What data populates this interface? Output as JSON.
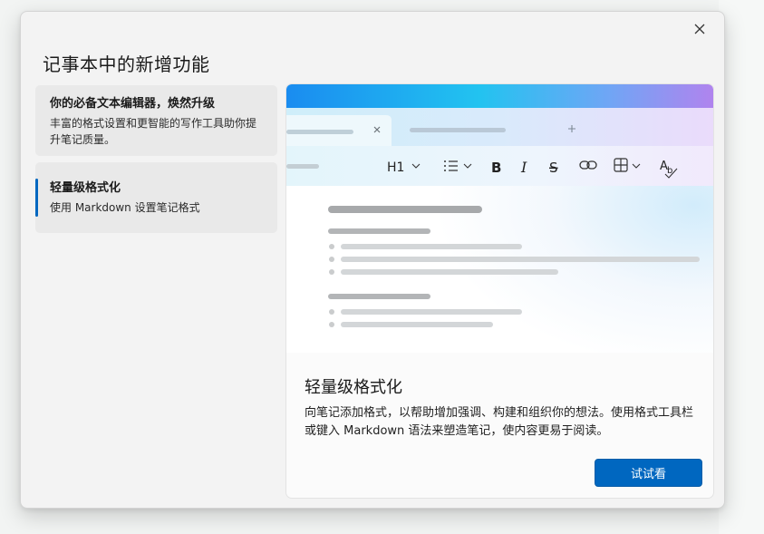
{
  "dialog": {
    "title": "记事本中的新增功能",
    "close_icon": "close-icon",
    "try_button": "试试看"
  },
  "sidebar": {
    "items": [
      {
        "title": "你的必备文本编辑器，焕然升级",
        "desc": "丰富的格式设置和更智能的写作工具助你提升笔记质量。",
        "selected": false
      },
      {
        "title": "轻量级格式化",
        "desc": "使用 Markdown 设置笔记格式",
        "selected": true
      }
    ]
  },
  "card": {
    "title": "轻量级格式化",
    "desc": "向笔记添加格式，以帮助增加强调、构建和组织你的想法。使用格式工具栏或键入 Markdown 语法来塑造笔记，使内容更易于阅读。"
  },
  "preview": {
    "heading_select": "H1",
    "tab_close_icon": "close-icon",
    "new_tab_icon": "plus-icon",
    "toolbar_icons": [
      "list-icon",
      "bold-icon",
      "italic-icon",
      "strikethrough-icon",
      "link-icon",
      "table-icon",
      "spellcheck-icon"
    ]
  },
  "colors": {
    "accent": "#0067c0",
    "selected_bg": "#e9e9e9"
  }
}
